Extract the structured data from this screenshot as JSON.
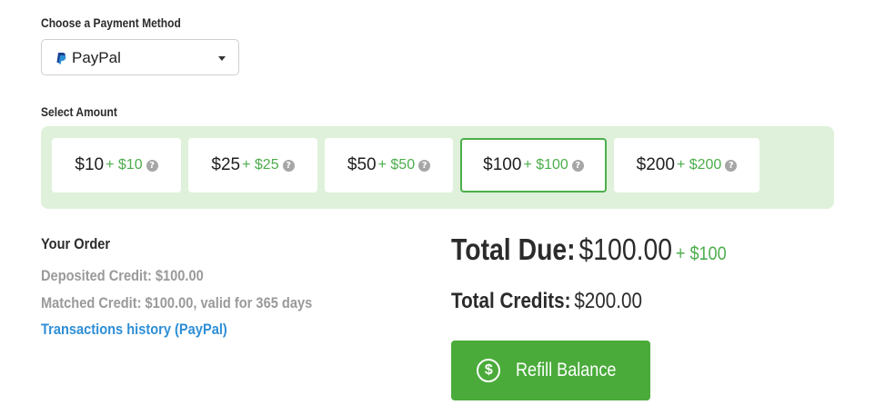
{
  "payment": {
    "label": "Choose a Payment Method",
    "selected": "PayPal"
  },
  "amount": {
    "label": "Select Amount",
    "options": [
      {
        "main": "$10",
        "bonus": "+ $10"
      },
      {
        "main": "$25",
        "bonus": "+ $25"
      },
      {
        "main": "$50",
        "bonus": "+ $50"
      },
      {
        "main": "$100",
        "bonus": "+ $100",
        "selected": true
      },
      {
        "main": "$200",
        "bonus": "+ $200"
      }
    ],
    "help_glyph": "?"
  },
  "order": {
    "title": "Your Order",
    "deposited": "Deposited Credit: $100.00",
    "matched": "Matched Credit: $100.00, valid for 365 days",
    "history_link": "Transactions history (PayPal)"
  },
  "totals": {
    "due_label": "Total Due:",
    "due_value": "$100.00",
    "due_bonus": "+ $100",
    "credits_label": "Total Credits:",
    "credits_value": "$200.00"
  },
  "refill": {
    "icon": "dollar-circle-icon",
    "icon_glyph": "$",
    "label": "Refill Balance"
  },
  "colors": {
    "accent_green": "#4cae4c",
    "button_green": "#4aab3a",
    "panel_bg": "#dff1da",
    "link_blue": "#2f8fd6"
  }
}
